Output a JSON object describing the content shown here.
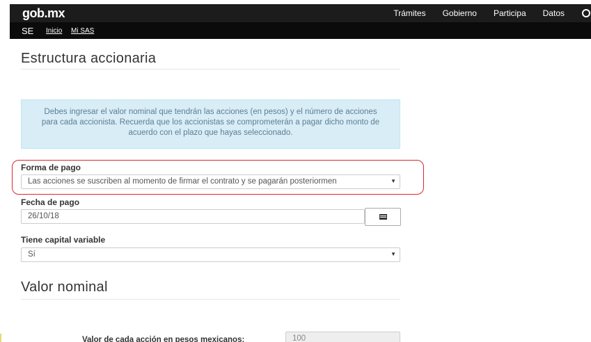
{
  "header": {
    "logo": "gob.mx",
    "nav": [
      "Trámites",
      "Gobierno",
      "Participa",
      "Datos"
    ]
  },
  "subnav": {
    "section": "SE",
    "links": [
      "Inicio",
      "Mi SAS"
    ]
  },
  "sections": {
    "estructura_title": "Estructura accionaria",
    "valor_title": "Valor nominal"
  },
  "alert": {
    "text": "Debes ingresar el valor nominal que tendrán las acciones (en pesos) y el número de acciones para cada accionista. Recuerda que los accionistas se comprometerán a pagar dicho monto de acuerdo con el plazo que hayas seleccionado."
  },
  "form": {
    "forma_pago": {
      "label": "Forma de pago",
      "value": "Las acciones se suscriben al momento de firmar el contrato y se pagarán posteriormen"
    },
    "fecha_pago": {
      "label": "Fecha de pago",
      "value": "26/10/18"
    },
    "capital_variable": {
      "label": "Tiene capital variable",
      "value": "Sí"
    },
    "valor_accion": {
      "label": "Valor de cada acción en pesos mexicanos:",
      "value": "100"
    }
  },
  "colors": {
    "highlight": "#d9272e",
    "alert_bg": "#d9edf7",
    "topbar": "#1c1c1c"
  }
}
